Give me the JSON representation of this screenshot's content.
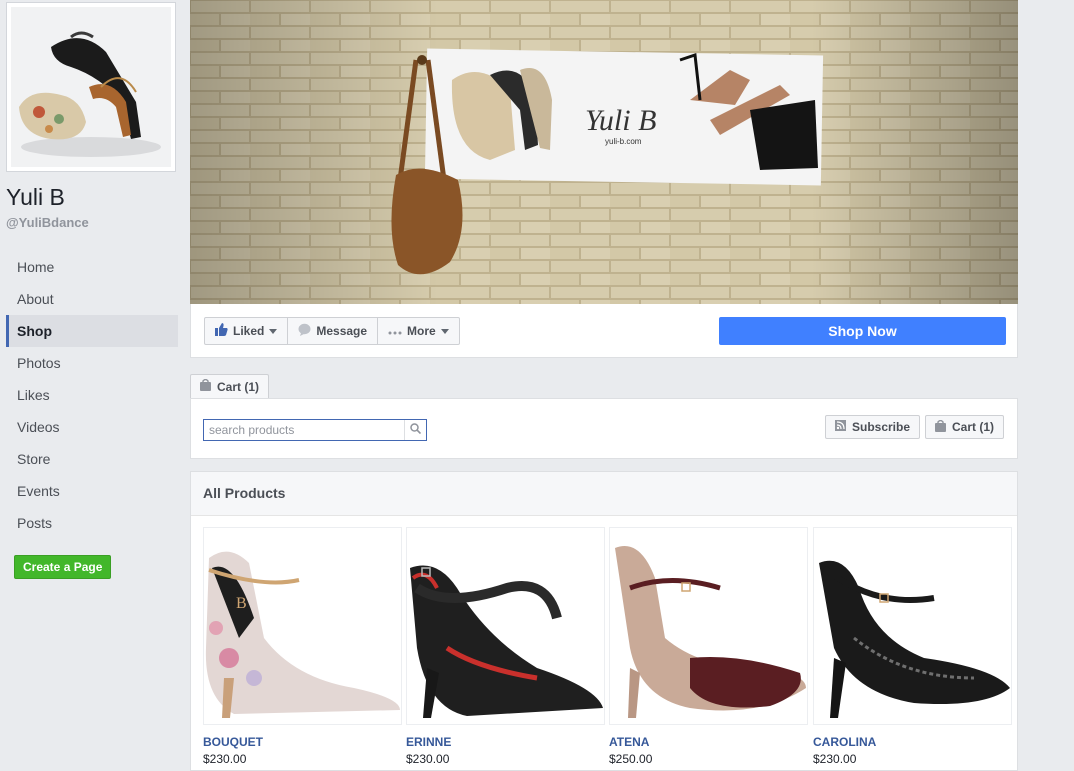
{
  "page": {
    "name": "Yuli B",
    "handle": "@YuliBdance",
    "cover_banner_brand": "Yuli B",
    "cover_banner_url": "yuli-b.com"
  },
  "nav": {
    "items": [
      "Home",
      "About",
      "Shop",
      "Photos",
      "Likes",
      "Videos",
      "Store",
      "Events",
      "Posts"
    ],
    "active": "Shop"
  },
  "create_page_label": "Create a Page",
  "actions": {
    "liked": "Liked",
    "message": "Message",
    "more": "More",
    "shop_now": "Shop Now"
  },
  "cart_tab_label": "Cart (1)",
  "search": {
    "placeholder": "search products"
  },
  "subscribe_label": "Subscribe",
  "cart_label": "Cart (1)",
  "products": {
    "header": "All Products",
    "items": [
      {
        "name": "BOUQUET",
        "price": "$230.00"
      },
      {
        "name": "ERINNE",
        "price": "$230.00"
      },
      {
        "name": "ATENA",
        "price": "$250.00"
      },
      {
        "name": "CAROLINA",
        "price": "$230.00"
      }
    ]
  },
  "colors": {
    "background": "#e9ebee",
    "accent_blue": "#4080ff",
    "link_blue": "#365899",
    "create_green": "#42b72a"
  },
  "icons": [
    "thumbs-up-icon",
    "message-bubble-icon",
    "more-dots-icon",
    "shopping-bag-icon",
    "search-icon",
    "rss-icon"
  ]
}
